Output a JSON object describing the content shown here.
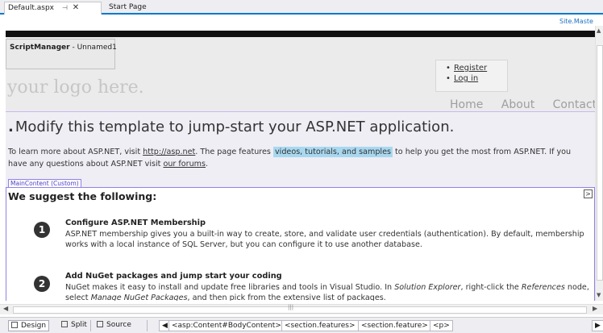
{
  "tabs": {
    "active": {
      "label": "Default.aspx",
      "pin_glyph": "⊣",
      "close_glyph": "✕"
    },
    "inactive": {
      "label": "Start Page"
    }
  },
  "master_page_link": "Site.Maste",
  "script_manager": {
    "name": "ScriptManager",
    "suffix": " - Unnamed1"
  },
  "logo_text": "your logo here.",
  "login": {
    "register": "Register",
    "log_in": "Log in"
  },
  "menu": [
    "Home",
    "About",
    "Contact"
  ],
  "featured": {
    "title": "Modify this template to jump-start your ASP.NET application.",
    "p_before_link": "To learn more about ASP.NET, visit ",
    "link_asp": "http://asp.net",
    "p_mid": ". The page features ",
    "highlight": "videos, tutorials, and samples",
    "p_after_highlight": " to help you get the most from ASP.NET. If you have any questions about ASP.NET visit ",
    "link_forums": "our forums",
    "p_end": "."
  },
  "main_content_label": "MainContent (Custom)",
  "expand_glyph": ">",
  "suggest_heading": "We suggest the following:",
  "steps": [
    {
      "number": "1",
      "title": "Configure ASP.NET Membership",
      "text": "ASP.NET membership gives you a built-in way to create, store, and validate user credentials (authentication). By default, membership works with a local instance of SQL Server, but you can configure it to use another database."
    },
    {
      "number": "2",
      "title": "Add NuGet packages and jump start your coding",
      "text_before_1": "NuGet makes it easy to install and update free libraries and tools in Visual Studio. In ",
      "italic_1": "Solution Explorer",
      "text_before_2": ", right-click the ",
      "italic_2": "References",
      "text_before_3": " node, select ",
      "italic_3": "Manage NuGet Packages",
      "text_after": ", and then pick from the extensive list of packages."
    }
  ],
  "status_bar": {
    "design": "Design",
    "split": "Split",
    "source": "Source",
    "crumbs": [
      "<asp:Content#BodyContent>",
      "<section.features>",
      "<section.feature>",
      "<p>"
    ]
  }
}
